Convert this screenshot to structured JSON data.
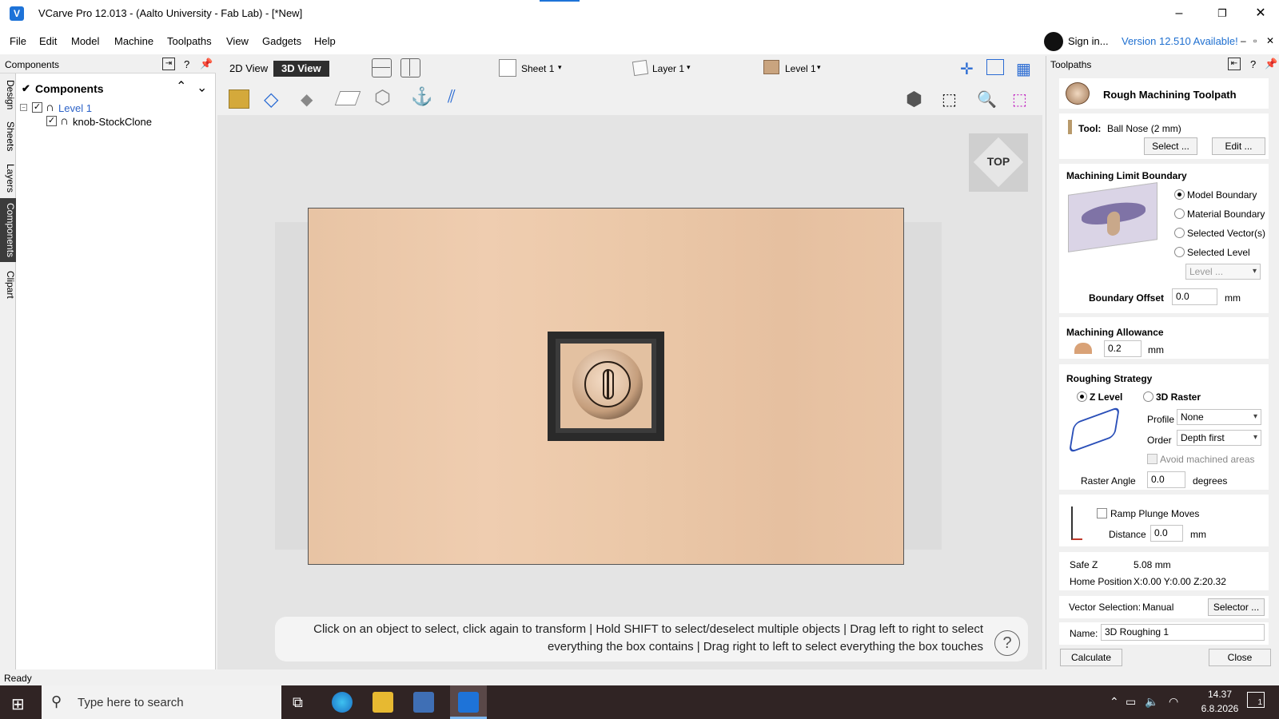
{
  "window": {
    "title": "VCarve Pro 12.013 - (Aalto University - Fab Lab) - [*New]",
    "app_icon": "vcarve-logo-icon",
    "minimize": "–",
    "maximize": "❐",
    "close": "✕"
  },
  "menu": {
    "items": [
      "File",
      "Edit",
      "Model",
      "Machine",
      "Toolpaths",
      "View",
      "Gadgets",
      "Help"
    ],
    "sign_in": "Sign in...",
    "version": "Version 12.510 Available!",
    "small_controls": [
      "–",
      "▫",
      "✕"
    ]
  },
  "left_panel": {
    "header": "Components",
    "help": "?",
    "tabs": [
      "Design",
      "Sheets",
      "Layers",
      "Components",
      "Clipart"
    ],
    "active_tab": "Components",
    "tree_title": "Components",
    "tree": [
      {
        "label": "Level 1",
        "checked": true,
        "level": 0,
        "color": "#2d63c8"
      },
      {
        "label": "knob-StockClone",
        "checked": true,
        "level": 1,
        "color": "#000000"
      }
    ]
  },
  "view": {
    "tabs": [
      "2D View",
      "3D View"
    ],
    "active_tab": "3D View",
    "sheet": "Sheet 1",
    "layer": "Layer 1",
    "level": "Level 1",
    "cube_label": "TOP",
    "hint_line1": "Click on an object to select, click again to transform | Hold SHIFT to select/deselect multiple objects | Drag left to right to select",
    "hint_line2": "everything the box contains | Drag right to left to select everything the box touches",
    "hint_help": "?"
  },
  "toolpath_panel": {
    "header": "Toolpaths",
    "help": "?",
    "title": "Rough Machining Toolpath",
    "tool_label": "Tool:",
    "tool_value": "Ball Nose (2 mm)",
    "select_button": "Select ...",
    "edit_button": "Edit ...",
    "boundary_title": "Machining Limit Boundary",
    "boundary_options": [
      "Model Boundary",
      "Material Boundary",
      "Selected Vector(s)",
      "Selected Level"
    ],
    "boundary_selected": "Model Boundary",
    "level_dropdown": "Level ...",
    "boundary_offset_label": "Boundary Offset",
    "boundary_offset_value": "0.0",
    "unit_mm": "mm",
    "allowance_title": "Machining Allowance",
    "allowance_value": "0.2",
    "strategy_title": "Roughing Strategy",
    "strategy_options": [
      "Z Level",
      "3D Raster"
    ],
    "strategy_selected": "Z Level",
    "profile_label": "Profile",
    "profile_value": "None",
    "order_label": "Order",
    "order_value": "Depth first",
    "avoid_label": "Avoid machined areas",
    "raster_angle_label": "Raster Angle",
    "raster_angle_value": "0.0",
    "degrees": "degrees",
    "ramp_label": "Ramp Plunge Moves",
    "distance_label": "Distance",
    "distance_value": "0.0",
    "safe_z_label": "Safe Z",
    "safe_z_value": "5.08 mm",
    "home_label": "Home Position",
    "home_value": "X:0.00 Y:0.00 Z:20.32",
    "vector_selection_label": "Vector Selection:",
    "vector_selection_value": "Manual",
    "selector_button": "Selector ...",
    "name_label": "Name:",
    "name_value": "3D Roughing 1",
    "calculate_button": "Calculate",
    "close_button": "Close"
  },
  "status": {
    "text": "Ready"
  },
  "taskbar": {
    "search_placeholder": "Type here to search",
    "time": "14.37",
    "date": "6.8.2026",
    "notification_count": "1"
  },
  "colors": {
    "accent": "#1e73d8",
    "link": "#1e6fd0",
    "wood": "#ebc8a8",
    "taskbar": "#302424"
  }
}
